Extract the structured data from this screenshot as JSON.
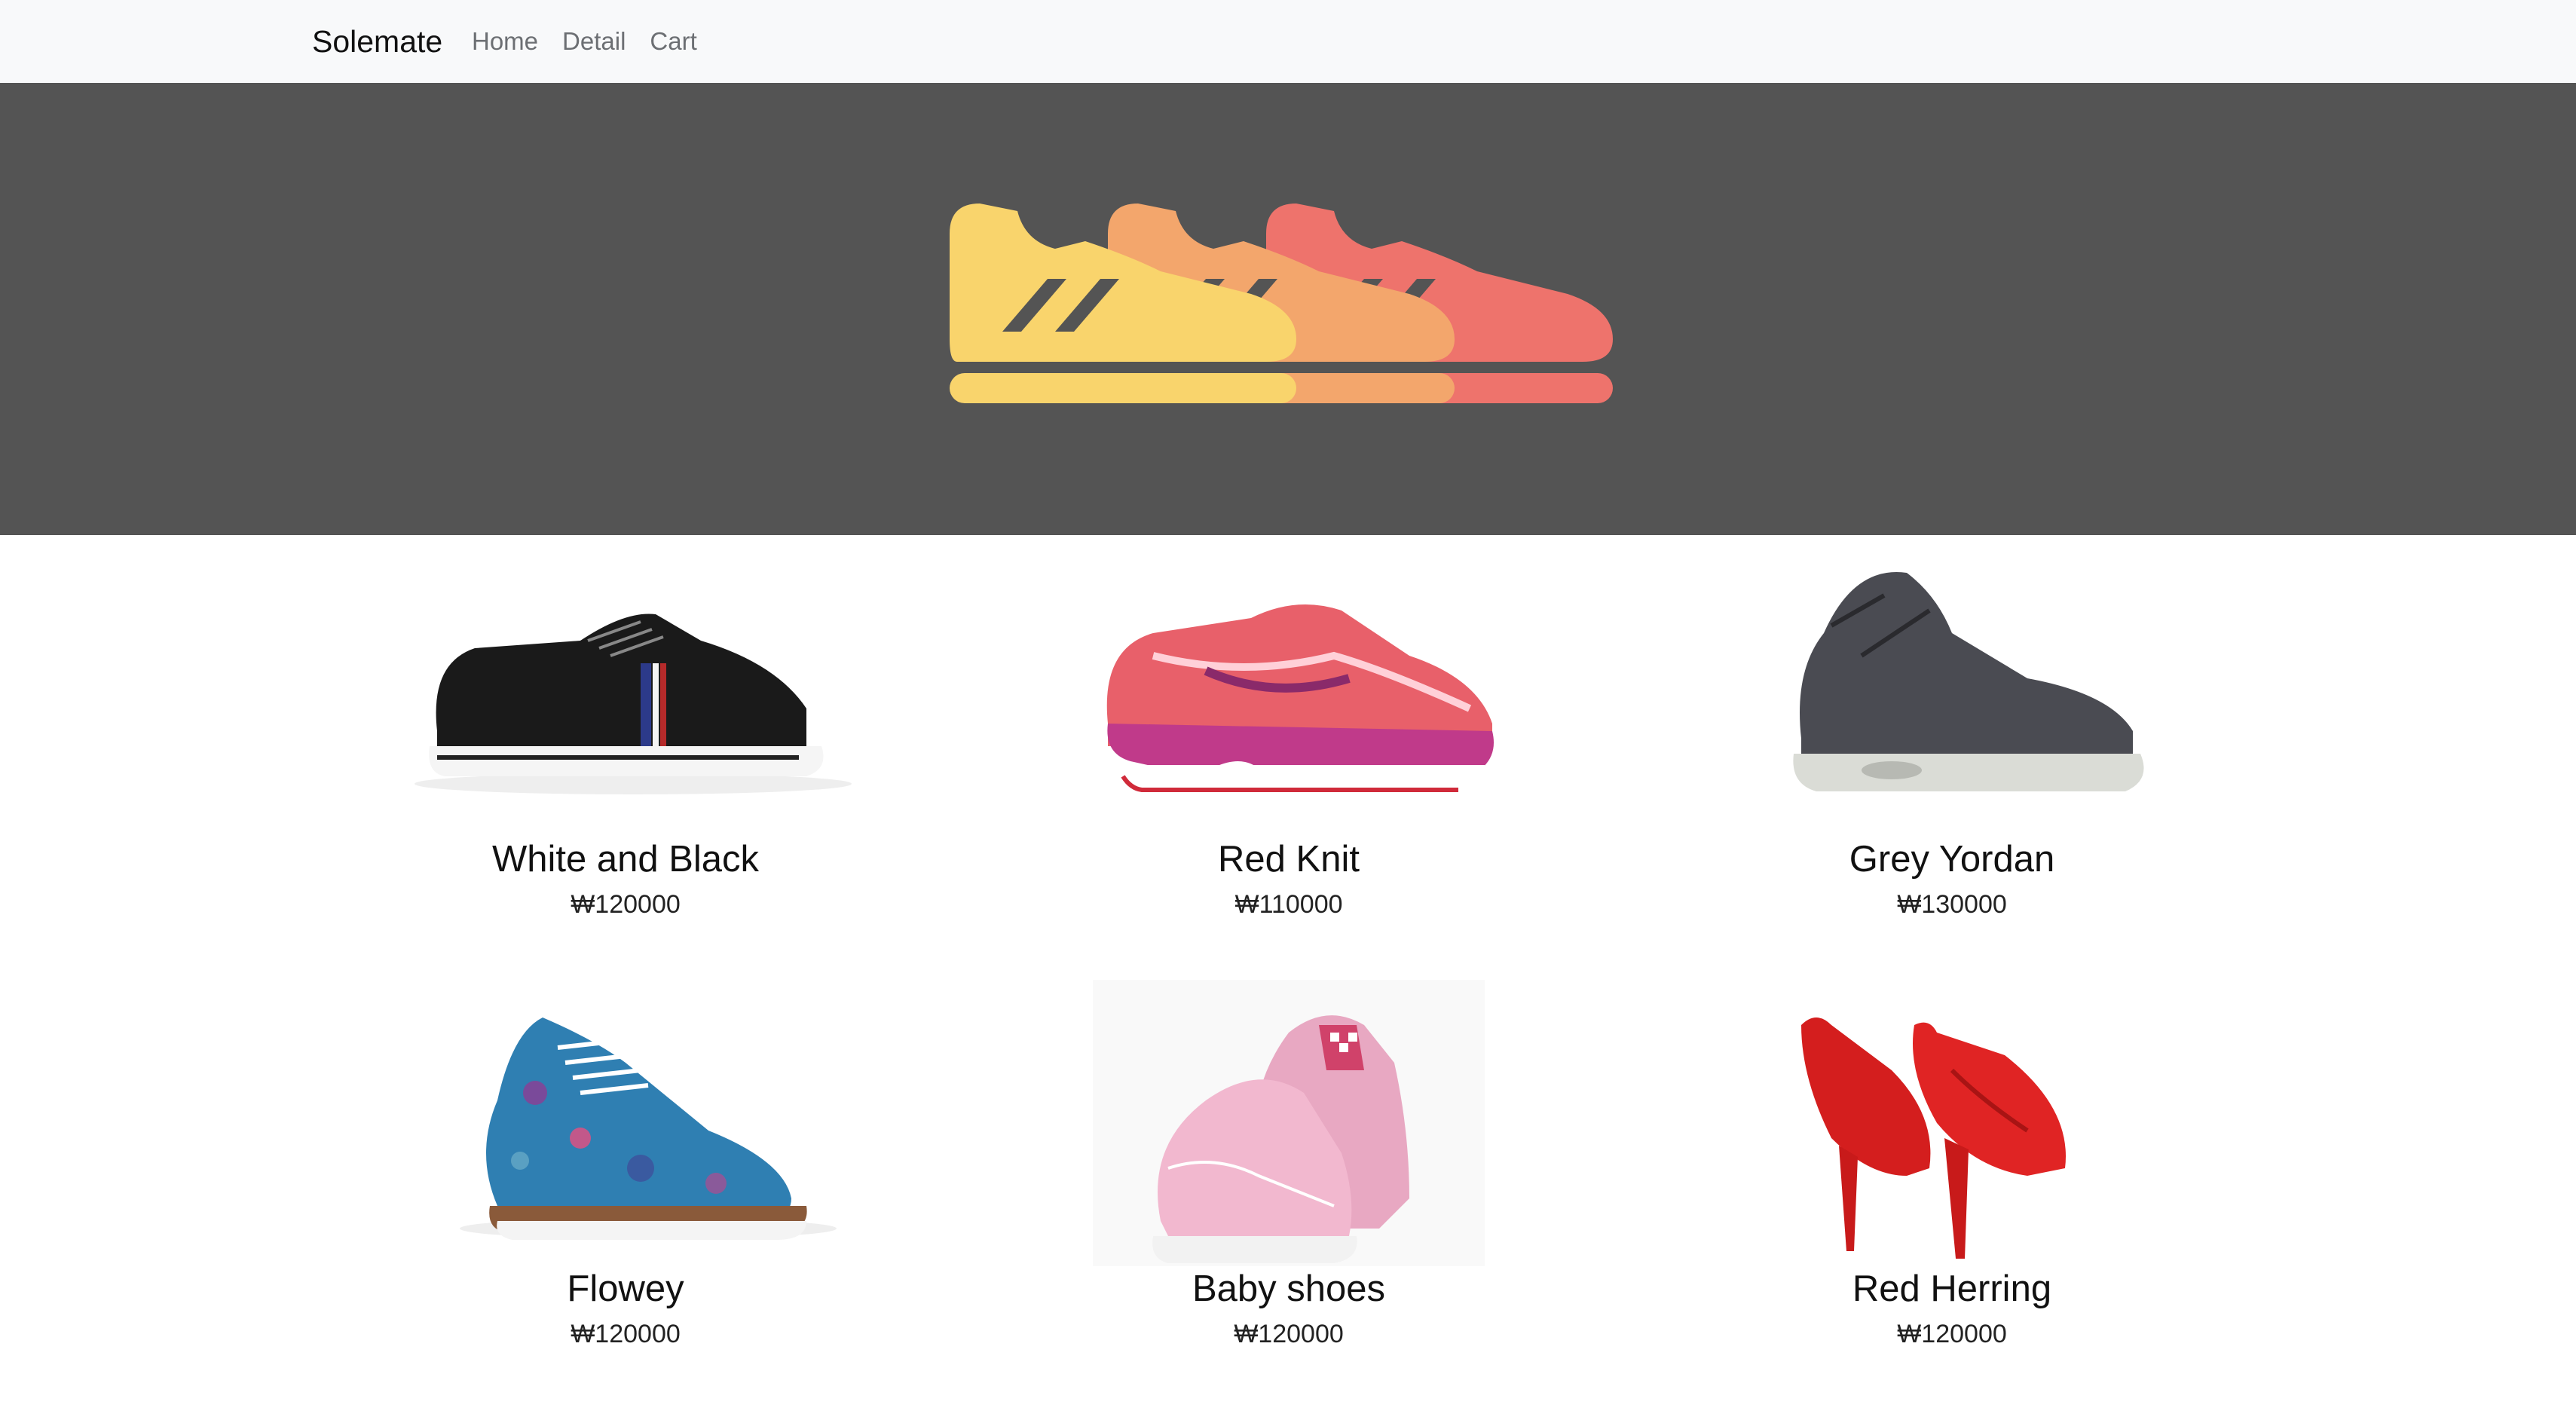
{
  "navbar": {
    "brand": "Solemate",
    "links": [
      "Home",
      "Detail",
      "Cart"
    ]
  },
  "hero": {
    "icon": "running-shoes-logo",
    "colors": [
      "#f9d46c",
      "#f3a66c",
      "#ee736c"
    ],
    "background": "#545454"
  },
  "products": [
    {
      "title": "White and Black",
      "price": "₩120000",
      "image": "black-canvas-sneaker"
    },
    {
      "title": "Red Knit",
      "price": "₩110000",
      "image": "pink-running-shoe"
    },
    {
      "title": "Grey Yordan",
      "price": "₩130000",
      "image": "grey-basketball-shoe"
    },
    {
      "title": "Flowey",
      "price": "₩120000",
      "image": "floral-blue-oxford"
    },
    {
      "title": "Baby shoes",
      "price": "₩120000",
      "image": "pink-slip-on-shoes"
    },
    {
      "title": "Red Herring",
      "price": "₩120000",
      "image": "red-high-heels"
    }
  ]
}
